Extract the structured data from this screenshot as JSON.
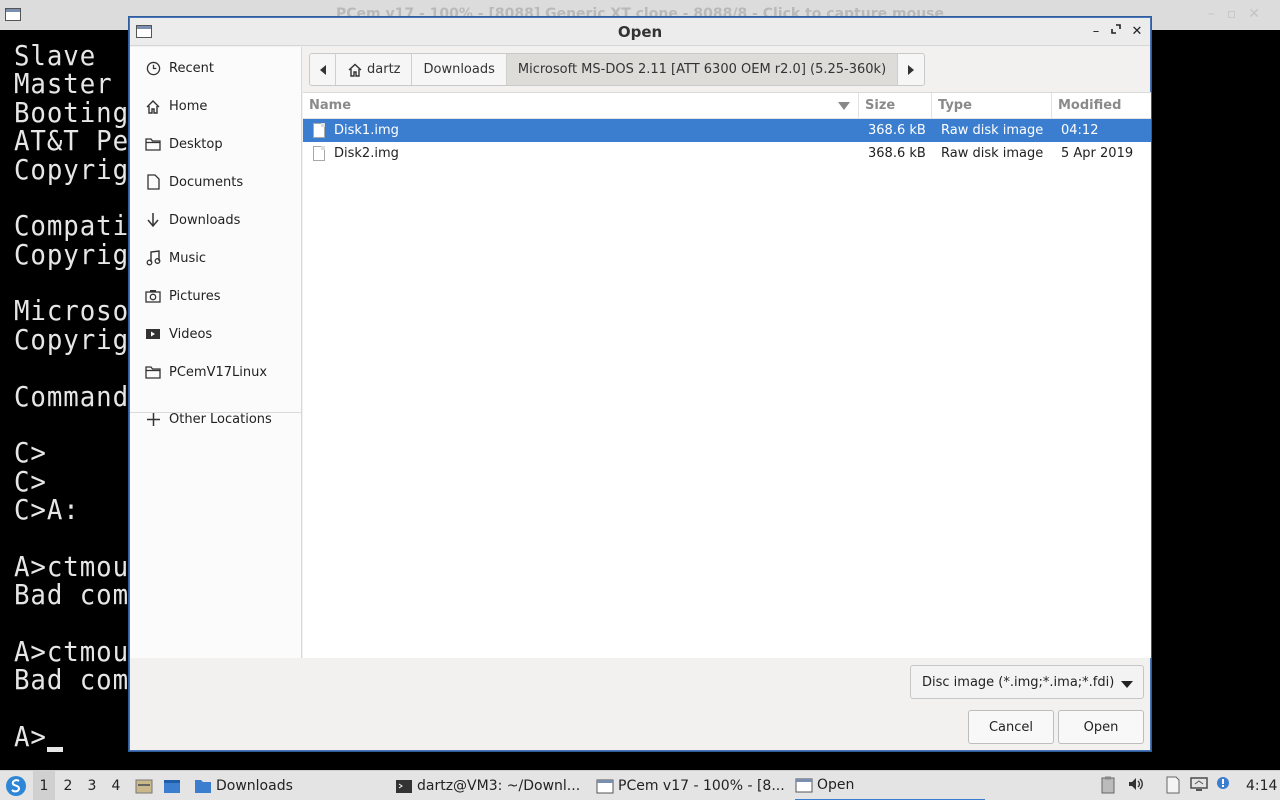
{
  "background_window": {
    "title": "PCem v17 - 100% - [8088] Generic XT clone - 8088/8 - Click to capture mouse",
    "terminal_lines": [
      "Slave",
      "Master",
      "Booting",
      "AT&T Pe",
      "Copyrig",
      "",
      "Compati",
      "Copyrig",
      "",
      "Microso",
      "Copyrig",
      "",
      "Command",
      "",
      "C>",
      "C>",
      "C>A:",
      "",
      "A>ctmous",
      "Bad com",
      "",
      "A>ctmous",
      "Bad com",
      "",
      "A>"
    ]
  },
  "dialog": {
    "title": "Open",
    "sidebar": [
      {
        "label": "Recent",
        "icon": "clock-icon"
      },
      {
        "label": "Home",
        "icon": "home-icon"
      },
      {
        "label": "Desktop",
        "icon": "folder-icon"
      },
      {
        "label": "Documents",
        "icon": "document-icon"
      },
      {
        "label": "Downloads",
        "icon": "download-icon"
      },
      {
        "label": "Music",
        "icon": "music-icon"
      },
      {
        "label": "Pictures",
        "icon": "camera-icon"
      },
      {
        "label": "Videos",
        "icon": "video-icon"
      },
      {
        "label": "PCemV17Linux",
        "icon": "folder-icon"
      },
      {
        "label": "Other Locations",
        "icon": "plus-icon"
      }
    ],
    "path": {
      "home": "dartz",
      "segments": [
        "Downloads",
        "Microsoft MS-DOS 2.11 [ATT 6300 OEM r2.0] (5.25-360k)"
      ]
    },
    "columns": {
      "name": "Name",
      "size": "Size",
      "type": "Type",
      "modified": "Modified"
    },
    "files": [
      {
        "name": "Disk1.img",
        "size": "368.6 kB",
        "type": "Raw disk image",
        "modified": "04:12",
        "selected": true
      },
      {
        "name": "Disk2.img",
        "size": "368.6 kB",
        "type": "Raw disk image",
        "modified": "5 Apr 2019",
        "selected": false
      }
    ],
    "filter": "Disc image (*.img;*.ima;*.fdi)",
    "buttons": {
      "cancel": "Cancel",
      "open": "Open"
    }
  },
  "taskbar": {
    "workspaces": [
      "1",
      "2",
      "3",
      "4"
    ],
    "tasks": [
      {
        "label": "Downloads"
      },
      {
        "label": "dartz@VM3: ~/Downl..."
      },
      {
        "label": "PCem v17 - 100% - [8..."
      },
      {
        "label": "Open"
      }
    ],
    "clock": "4:14"
  }
}
